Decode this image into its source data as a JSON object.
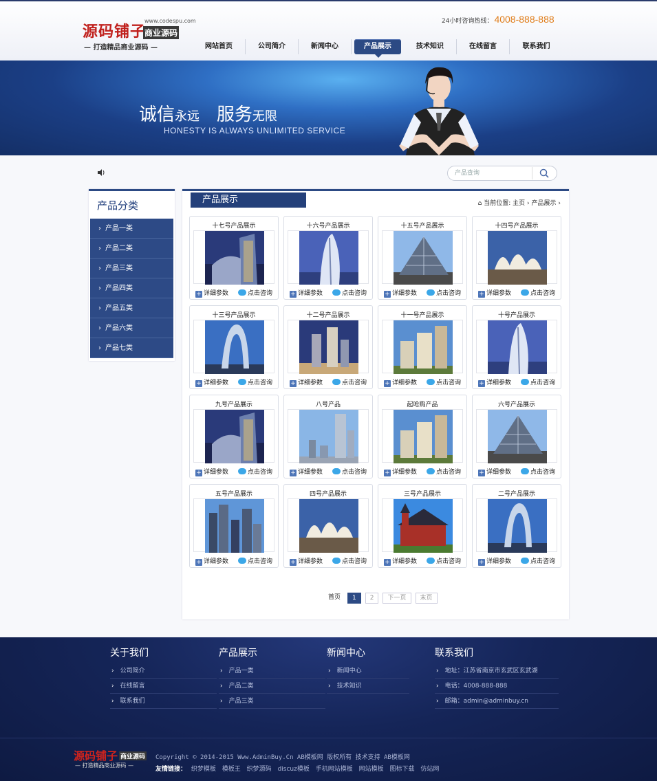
{
  "header": {
    "logo_main": "源码铺子",
    "logo_badge": "商业源码",
    "logo_url": "www.codespu.com",
    "logo_slogan": "— 打造精品商业源码 —",
    "hotline_label": "24小时咨询热线：",
    "hotline_number": "4008-888-888",
    "nav": [
      "网站首页",
      "公司简介",
      "新闻中心",
      "产品展示",
      "技术知识",
      "在线留言",
      "联系我们"
    ],
    "nav_active": "产品展示"
  },
  "banner": {
    "title_1": "诚信",
    "title_1_small": "永远",
    "title_2": "服务",
    "title_2_small": "无限",
    "subtitle": "HONESTY IS ALWAYS UNLIMITED SERVICE"
  },
  "search": {
    "placeholder": "产品查询"
  },
  "sidebar": {
    "title": "产品分类",
    "items": [
      "产品一类",
      "产品二类",
      "产品三类",
      "产品四类",
      "产品五类",
      "产品六类",
      "产品七类"
    ]
  },
  "main": {
    "title": "产品展示",
    "breadcrumb_label": "当前位置:",
    "breadcrumb_home": "主页",
    "breadcrumb_current": "产品展示",
    "detail_label": "详细参数",
    "consult_label": "点击咨询",
    "products": [
      {
        "title": "十七号产品展示",
        "image": "modern-building"
      },
      {
        "title": "十六号产品展示",
        "image": "sail-tower"
      },
      {
        "title": "十五号产品展示",
        "image": "glass-pyramid"
      },
      {
        "title": "十四号产品展示",
        "image": "opera-house"
      },
      {
        "title": "十三号产品展示",
        "image": "arch-building"
      },
      {
        "title": "十二号产品展示",
        "image": "highrise-towers"
      },
      {
        "title": "十一号产品展示",
        "image": "apartment-blocks"
      },
      {
        "title": "十号产品展示",
        "image": "sail-tower"
      },
      {
        "title": "九号产品展示",
        "image": "modern-building"
      },
      {
        "title": "八号产品",
        "image": "skyscrapers"
      },
      {
        "title": "起呛购产品",
        "image": "apartment-blocks"
      },
      {
        "title": "六号产品展示",
        "image": "glass-pyramid"
      },
      {
        "title": "五号产品展示",
        "image": "city-skyline"
      },
      {
        "title": "四号产品展示",
        "image": "opera-house"
      },
      {
        "title": "三号产品展示",
        "image": "red-house"
      },
      {
        "title": "二号产品展示",
        "image": "arch-building"
      }
    ],
    "pager": {
      "first": "首页",
      "pages": [
        "1",
        "2"
      ],
      "current": "1",
      "next": "下一页",
      "last": "末页"
    }
  },
  "footer": {
    "columns": [
      {
        "title": "关于我们",
        "items": [
          "公司简介",
          "在线留言",
          "联系我们"
        ]
      },
      {
        "title": "产品展示",
        "items": [
          "产品一类",
          "产品二类",
          "产品三类"
        ]
      },
      {
        "title": "新闻中心",
        "items": [
          "新闻中心",
          "技术知识"
        ]
      },
      {
        "title": "联系我们",
        "items": [
          "地址：江苏省南京市玄武区玄武湖",
          "电话：4008-888-888",
          "邮箱：admin@adminbuy.cn"
        ]
      }
    ],
    "logo_main": "源码铺子",
    "logo_badge": "商业源码",
    "logo_slogan": "— 打造精品商业源码 —",
    "copyright": "Copyright © 2014-2015 Www.AdminBuy.Cn AB模板网 版权所有  技术支持 AB模板网",
    "friend_links_label": "友情链接：",
    "friend_links": [
      "织梦模板",
      "模板王",
      "织梦源码",
      "discuz模板",
      "手机网站模板",
      "网站模板",
      "图标下载",
      "仿站网"
    ]
  },
  "colors": {
    "primary": "#2c4a84",
    "accent": "#e07d1a",
    "brand_red": "#c0201c"
  }
}
